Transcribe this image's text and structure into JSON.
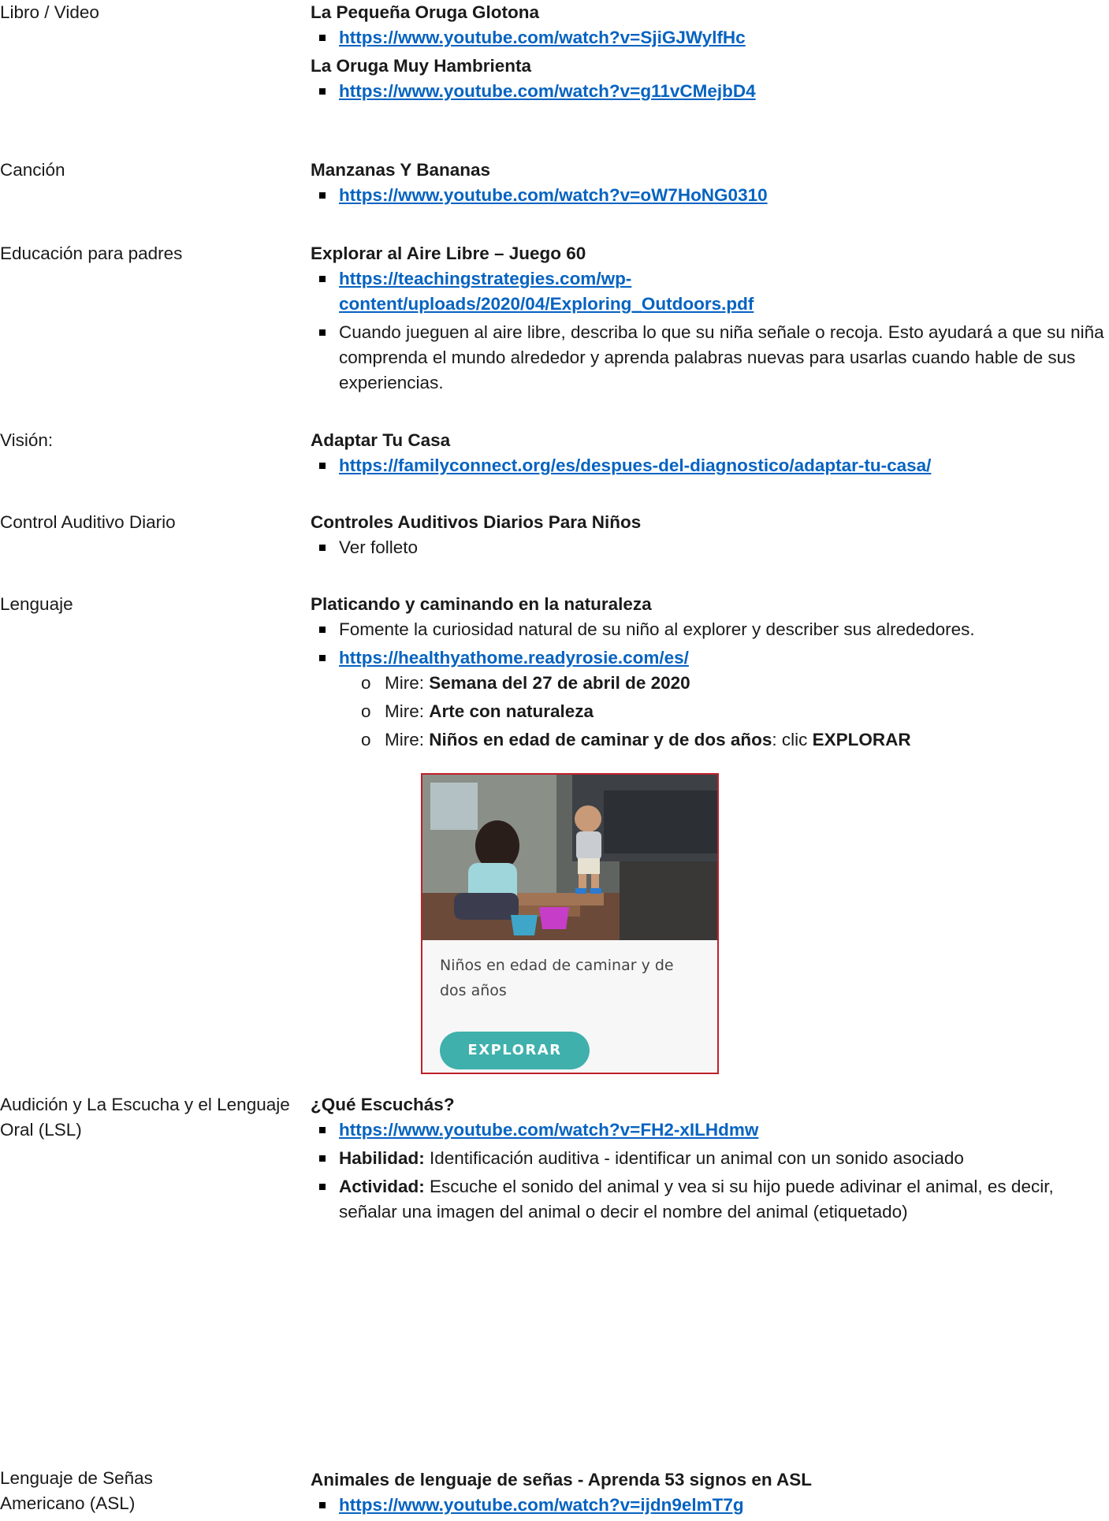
{
  "sections": {
    "libro": {
      "label": "Libro / Video",
      "title1": "La Pequeña Oruga Glotona",
      "link1": "https://www.youtube.com/watch?v=SjiGJWylfHc",
      "title2": "La Oruga Muy Hambrienta",
      "link2": "https://www.youtube.com/watch?v=g11vCMejbD4"
    },
    "cancion": {
      "label": "Canción",
      "title": "Manzanas Y Bananas",
      "link": "https://www.youtube.com/watch?v=oW7HoNG0310"
    },
    "padres": {
      "label": "Educación para padres",
      "title": "Explorar al Aire Libre – Juego 60",
      "link_line1": "https://teachingstrategies.com/wp-",
      "link_line2": "content/uploads/2020/04/Exploring_Outdoors.pdf",
      "text": "Cuando jueguen al aire libre, describa lo que su niña señale o recoja. Esto ayudará a que su niña comprenda el mundo alrededor y aprenda palabras nuevas para usarlas cuando hable de sus experiencias."
    },
    "vision": {
      "label": "Visión:",
      "title": "Adaptar Tu Casa",
      "link": "https://familyconnect.org/es/despues-del-diagnostico/adaptar-tu-casa/"
    },
    "control": {
      "label": "Control Auditivo Diario",
      "title": "Controles Auditivos Diarios Para Niños",
      "text": "Ver folleto"
    },
    "lenguaje": {
      "label": "Lenguaje",
      "title": "Platicando y caminando en la naturaleza",
      "text": "Fomente la curiosidad natural de su niño al explorer y describer sus alrededores.",
      "link": "https://healthyathome.readyrosie.com/es/",
      "mire_prefix": "Mire: ",
      "sub1": "Semana del 27 de abril de 2020",
      "sub2": "Arte con naturaleza",
      "sub3": "Niños en edad de caminar y de dos años",
      "sub3_mid": ": clic ",
      "sub3_end": "EXPLORAR",
      "card_caption": "Niños en edad de caminar y de dos años",
      "card_button": "EXPLORAR"
    },
    "lsl": {
      "label": "Audición y La Escucha y el Lenguaje Oral (LSL)",
      "title": "¿Qué Escuchás?",
      "link": "https://www.youtube.com/watch?v=FH2-xILHdmw",
      "hab_label": "Habilidad:",
      "hab_text": " Identificación auditiva - identificar un animal con un sonido asociado",
      "act_label": "Actividad:",
      "act_text": " Escuche el sonido del animal y vea si su hijo puede adivinar el animal, es decir, señalar una imagen del animal o decir el nombre del animal (etiquetado)"
    },
    "asl": {
      "label": "Lenguaje de Señas Americano (ASL)",
      "title": "Animales de lenguaje de señas - Aprenda 53 signos en ASL",
      "link": "https://www.youtube.com/watch?v=ijdn9elmT7g"
    }
  },
  "colors": {
    "link": "#0563c1",
    "button": "#3fb0ac",
    "card_border": "#c0202a"
  }
}
